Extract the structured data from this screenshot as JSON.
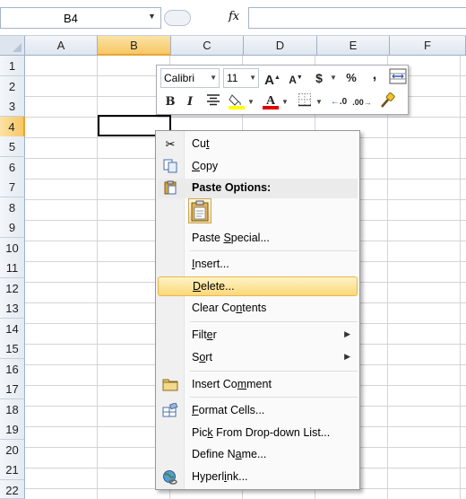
{
  "formula_bar": {
    "name_box": "B4",
    "fx": "fx",
    "formula": ""
  },
  "grid": {
    "columns": [
      "A",
      "B",
      "C",
      "D",
      "E",
      "F"
    ],
    "rows": [
      "1",
      "2",
      "3",
      "4",
      "5",
      "6",
      "7",
      "8",
      "9",
      "10",
      "11",
      "12",
      "13",
      "14",
      "15",
      "16",
      "17",
      "18",
      "19",
      "20",
      "21",
      "22"
    ],
    "selected_column": "B",
    "selected_row": "4"
  },
  "mini_toolbar": {
    "font_name": "Calibri",
    "font_size": "11",
    "grow_font": "A",
    "shrink_font": "A",
    "currency": "$",
    "percent": "%",
    "comma": ",",
    "bold": "B",
    "italic": "I",
    "font_color_glyph": "A",
    "increase_decimal": ".0",
    "decrease_decimal": ".00",
    "highlight_color": "#ffff00",
    "font_color": "#e00000"
  },
  "context_menu": {
    "cut": {
      "pre": "Cu",
      "ul": "t",
      "post": ""
    },
    "copy": {
      "pre": "",
      "ul": "C",
      "post": "opy"
    },
    "paste_options": "Paste Options:",
    "paste_special": {
      "pre": "Paste ",
      "ul": "S",
      "post": "pecial..."
    },
    "insert": {
      "pre": "",
      "ul": "I",
      "post": "nsert..."
    },
    "delete": {
      "pre": "",
      "ul": "D",
      "post": "elete..."
    },
    "clear_contents": {
      "pre": "Clear Co",
      "ul": "n",
      "post": "tents"
    },
    "filter": {
      "pre": "Filt",
      "ul": "e",
      "post": "r"
    },
    "sort": {
      "pre": "S",
      "ul": "o",
      "post": "rt"
    },
    "insert_comment": {
      "pre": "Insert Co",
      "ul": "m",
      "post": "ment"
    },
    "format_cells": {
      "pre": "",
      "ul": "F",
      "post": "ormat Cells..."
    },
    "pick_list": {
      "pre": "Pic",
      "ul": "k",
      "post": " From Drop-down List..."
    },
    "define_name": {
      "pre": "Define N",
      "ul": "a",
      "post": "me..."
    },
    "hyperlink": {
      "pre": "Hyperl",
      "ul": "i",
      "post": "nk..."
    },
    "hovered_item": "Delete..."
  }
}
